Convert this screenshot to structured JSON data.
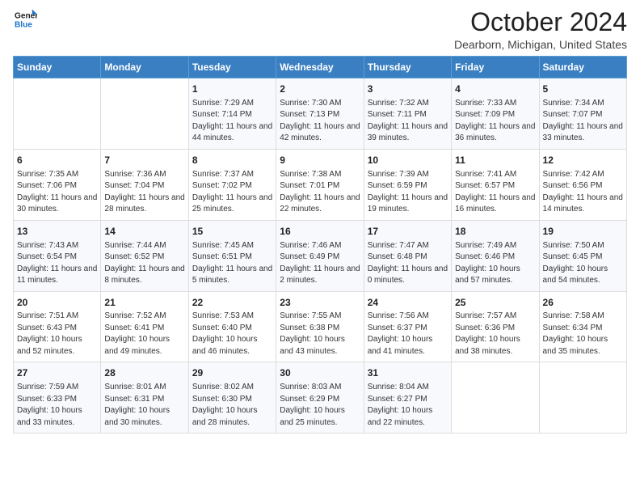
{
  "logo": {
    "line1": "General",
    "line2": "Blue"
  },
  "title": "October 2024",
  "subtitle": "Dearborn, Michigan, United States",
  "days_of_week": [
    "Sunday",
    "Monday",
    "Tuesday",
    "Wednesday",
    "Thursday",
    "Friday",
    "Saturday"
  ],
  "weeks": [
    [
      {
        "num": "",
        "info": ""
      },
      {
        "num": "",
        "info": ""
      },
      {
        "num": "1",
        "info": "Sunrise: 7:29 AM\nSunset: 7:14 PM\nDaylight: 11 hours and 44 minutes."
      },
      {
        "num": "2",
        "info": "Sunrise: 7:30 AM\nSunset: 7:13 PM\nDaylight: 11 hours and 42 minutes."
      },
      {
        "num": "3",
        "info": "Sunrise: 7:32 AM\nSunset: 7:11 PM\nDaylight: 11 hours and 39 minutes."
      },
      {
        "num": "4",
        "info": "Sunrise: 7:33 AM\nSunset: 7:09 PM\nDaylight: 11 hours and 36 minutes."
      },
      {
        "num": "5",
        "info": "Sunrise: 7:34 AM\nSunset: 7:07 PM\nDaylight: 11 hours and 33 minutes."
      }
    ],
    [
      {
        "num": "6",
        "info": "Sunrise: 7:35 AM\nSunset: 7:06 PM\nDaylight: 11 hours and 30 minutes."
      },
      {
        "num": "7",
        "info": "Sunrise: 7:36 AM\nSunset: 7:04 PM\nDaylight: 11 hours and 28 minutes."
      },
      {
        "num": "8",
        "info": "Sunrise: 7:37 AM\nSunset: 7:02 PM\nDaylight: 11 hours and 25 minutes."
      },
      {
        "num": "9",
        "info": "Sunrise: 7:38 AM\nSunset: 7:01 PM\nDaylight: 11 hours and 22 minutes."
      },
      {
        "num": "10",
        "info": "Sunrise: 7:39 AM\nSunset: 6:59 PM\nDaylight: 11 hours and 19 minutes."
      },
      {
        "num": "11",
        "info": "Sunrise: 7:41 AM\nSunset: 6:57 PM\nDaylight: 11 hours and 16 minutes."
      },
      {
        "num": "12",
        "info": "Sunrise: 7:42 AM\nSunset: 6:56 PM\nDaylight: 11 hours and 14 minutes."
      }
    ],
    [
      {
        "num": "13",
        "info": "Sunrise: 7:43 AM\nSunset: 6:54 PM\nDaylight: 11 hours and 11 minutes."
      },
      {
        "num": "14",
        "info": "Sunrise: 7:44 AM\nSunset: 6:52 PM\nDaylight: 11 hours and 8 minutes."
      },
      {
        "num": "15",
        "info": "Sunrise: 7:45 AM\nSunset: 6:51 PM\nDaylight: 11 hours and 5 minutes."
      },
      {
        "num": "16",
        "info": "Sunrise: 7:46 AM\nSunset: 6:49 PM\nDaylight: 11 hours and 2 minutes."
      },
      {
        "num": "17",
        "info": "Sunrise: 7:47 AM\nSunset: 6:48 PM\nDaylight: 11 hours and 0 minutes."
      },
      {
        "num": "18",
        "info": "Sunrise: 7:49 AM\nSunset: 6:46 PM\nDaylight: 10 hours and 57 minutes."
      },
      {
        "num": "19",
        "info": "Sunrise: 7:50 AM\nSunset: 6:45 PM\nDaylight: 10 hours and 54 minutes."
      }
    ],
    [
      {
        "num": "20",
        "info": "Sunrise: 7:51 AM\nSunset: 6:43 PM\nDaylight: 10 hours and 52 minutes."
      },
      {
        "num": "21",
        "info": "Sunrise: 7:52 AM\nSunset: 6:41 PM\nDaylight: 10 hours and 49 minutes."
      },
      {
        "num": "22",
        "info": "Sunrise: 7:53 AM\nSunset: 6:40 PM\nDaylight: 10 hours and 46 minutes."
      },
      {
        "num": "23",
        "info": "Sunrise: 7:55 AM\nSunset: 6:38 PM\nDaylight: 10 hours and 43 minutes."
      },
      {
        "num": "24",
        "info": "Sunrise: 7:56 AM\nSunset: 6:37 PM\nDaylight: 10 hours and 41 minutes."
      },
      {
        "num": "25",
        "info": "Sunrise: 7:57 AM\nSunset: 6:36 PM\nDaylight: 10 hours and 38 minutes."
      },
      {
        "num": "26",
        "info": "Sunrise: 7:58 AM\nSunset: 6:34 PM\nDaylight: 10 hours and 35 minutes."
      }
    ],
    [
      {
        "num": "27",
        "info": "Sunrise: 7:59 AM\nSunset: 6:33 PM\nDaylight: 10 hours and 33 minutes."
      },
      {
        "num": "28",
        "info": "Sunrise: 8:01 AM\nSunset: 6:31 PM\nDaylight: 10 hours and 30 minutes."
      },
      {
        "num": "29",
        "info": "Sunrise: 8:02 AM\nSunset: 6:30 PM\nDaylight: 10 hours and 28 minutes."
      },
      {
        "num": "30",
        "info": "Sunrise: 8:03 AM\nSunset: 6:29 PM\nDaylight: 10 hours and 25 minutes."
      },
      {
        "num": "31",
        "info": "Sunrise: 8:04 AM\nSunset: 6:27 PM\nDaylight: 10 hours and 22 minutes."
      },
      {
        "num": "",
        "info": ""
      },
      {
        "num": "",
        "info": ""
      }
    ]
  ]
}
